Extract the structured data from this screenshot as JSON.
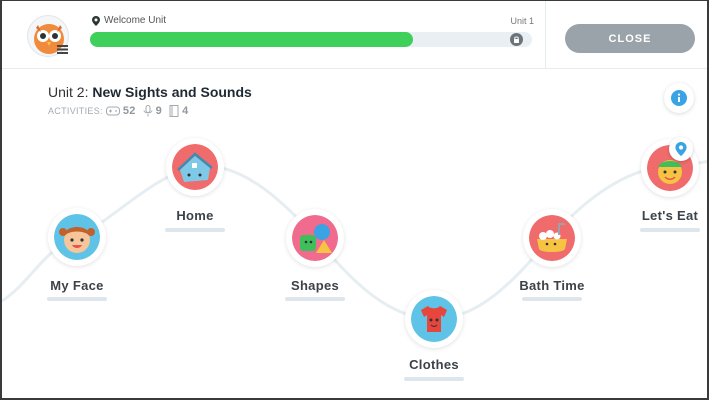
{
  "header": {
    "current_unit_label": "Welcome Unit",
    "unit_number_label": "Unit 1",
    "progress_fraction": 0.73,
    "close_label": "CLOSE"
  },
  "unit": {
    "prefix": "Unit 2: ",
    "name": "New Sights and Sounds",
    "activities_label": "ACTIVITIES:",
    "games_count": "52",
    "audio_count": "9",
    "books_count": "4"
  },
  "lessons": [
    {
      "label": "My Face",
      "icon": "girl-face-icon",
      "color": "#5ec3e6"
    },
    {
      "label": "Home",
      "icon": "house-icon",
      "color": "#f06b6b"
    },
    {
      "label": "Shapes",
      "icon": "shapes-icon",
      "color": "#f06b8d"
    },
    {
      "label": "Clothes",
      "icon": "shirt-icon",
      "color": "#5ec3e6"
    },
    {
      "label": "Bath Time",
      "icon": "bathtub-icon",
      "color": "#f06b6b"
    },
    {
      "label": "Let's Eat",
      "icon": "food-icon",
      "color": "#f06b6b"
    }
  ],
  "colors": {
    "progress": "#3fcf5b",
    "close_button": "#9aa3a9",
    "info": "#3aa3e3"
  }
}
